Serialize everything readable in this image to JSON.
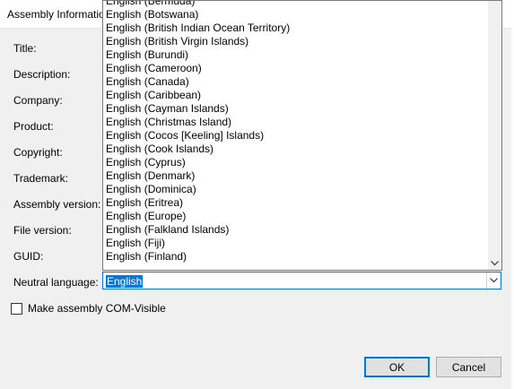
{
  "dialog": {
    "title": "Assembly Information"
  },
  "form": {
    "labels": [
      "Title:",
      "Description:",
      "Company:",
      "Product:",
      "Copyright:",
      "Trademark:",
      "Assembly version:",
      "File version:",
      "GUID:",
      "Neutral language:"
    ],
    "neutral_language_value": "English",
    "com_visible_label": "Make assembly COM-Visible"
  },
  "dropdown": {
    "options": [
      "English (Bermuda)",
      "English (Botswana)",
      "English (British Indian Ocean Territory)",
      "English (British Virgin Islands)",
      "English (Burundi)",
      "English (Cameroon)",
      "English (Canada)",
      "English (Caribbean)",
      "English (Cayman Islands)",
      "English (Christmas Island)",
      "English (Cocos [Keeling] Islands)",
      "English (Cook Islands)",
      "English (Cyprus)",
      "English (Denmark)",
      "English (Dominica)",
      "English (Eritrea)",
      "English (Europe)",
      "English (Falkland Islands)",
      "English (Fiji)",
      "English (Finland)"
    ]
  },
  "buttons": {
    "ok_label": "OK",
    "cancel_label": "Cancel"
  },
  "colors": {
    "accent": "#0078d7",
    "dialog_bg": "#f0f0f0"
  }
}
